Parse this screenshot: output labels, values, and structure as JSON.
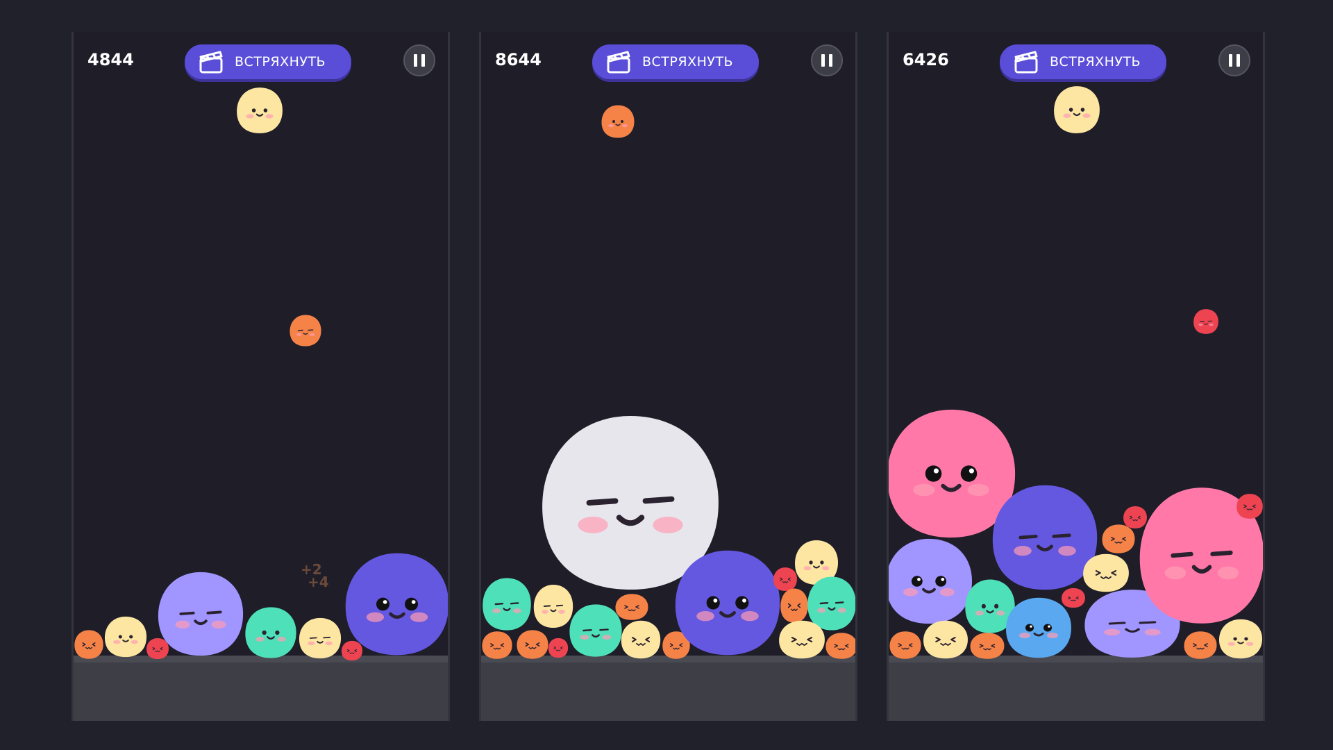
{
  "colors": {
    "background": "#21212b",
    "panel": "#1e1d28",
    "accent_button": "#5a4ed9",
    "blob_orange": "#f58348",
    "blob_yellow": "#fde6a2",
    "blob_red": "#ee4452",
    "blob_lavender": "#a195ff",
    "blob_mint": "#4ee0b8",
    "blob_indigo": "#6457e0",
    "blob_white": "#e6e6ec",
    "blob_pink": "#ff78a8",
    "blob_blue": "#5aa8f0"
  },
  "icons": {
    "shake": "clapperboard-icon",
    "pause": "pause-icon"
  },
  "panels": [
    {
      "score": "4844",
      "shake_label": "ВСТРЯХНУТЬ",
      "popups": [
        "+2",
        "+4"
      ]
    },
    {
      "score": "8644",
      "shake_label": "ВСТРЯХНУТЬ"
    },
    {
      "score": "6426",
      "shake_label": "ВСТРЯХНУТЬ"
    }
  ]
}
